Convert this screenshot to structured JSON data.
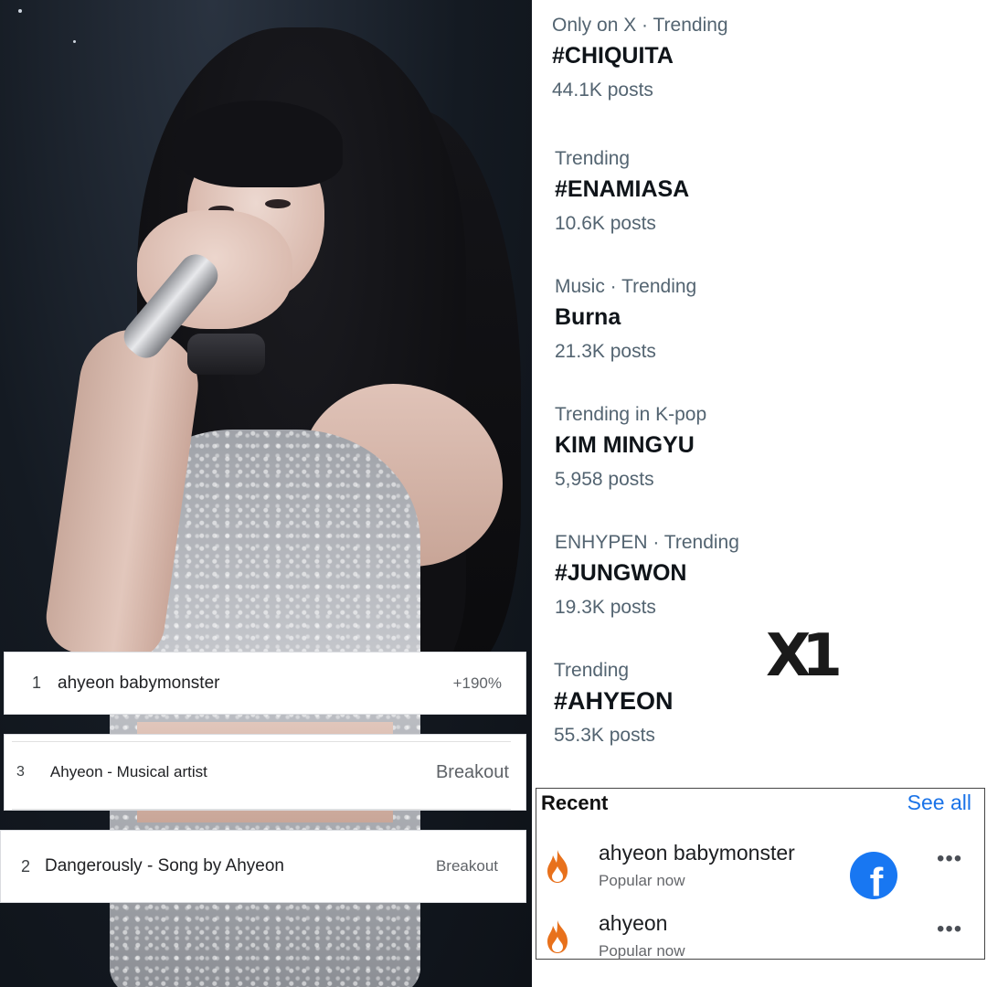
{
  "google_trends": [
    {
      "rank": "1",
      "term": "ahyeon babymonster",
      "value": "+190%"
    },
    {
      "rank": "3",
      "term": "Ahyeon - Musical artist",
      "value": "Breakout"
    },
    {
      "rank": "2",
      "term": "Dangerously - Song by Ahyeon",
      "value": "Breakout"
    }
  ],
  "x_trends": [
    {
      "meta": "Only on X · Trending",
      "title": "#CHIQUITA",
      "count": "44.1K posts"
    },
    {
      "meta": "Trending",
      "title": "#ENAMIASA",
      "count": "10.6K posts"
    },
    {
      "meta": "Music · Trending",
      "title": "Burna",
      "count": "21.3K posts"
    },
    {
      "meta": "Trending in K-pop",
      "title": "KIM MINGYU",
      "count": "5,958 posts"
    },
    {
      "meta": "ENHYPEN · Trending",
      "title": "#JUNGWON",
      "count": "19.3K posts"
    },
    {
      "meta": "Trending",
      "title": "#AHYEON",
      "count": "55.3K posts"
    }
  ],
  "watermark": "X1",
  "recent": {
    "header": "Recent",
    "see_all": "See all",
    "items": [
      {
        "name": "ahyeon babymonster",
        "sub": "Popular now",
        "icon": "fire-icon"
      },
      {
        "name": "ahyeon",
        "sub": "Popular now",
        "icon": "fire-icon"
      }
    ],
    "more": "•••",
    "fb_glyph": "f"
  },
  "colors": {
    "x_meta": "#536471",
    "x_title": "#0f1419",
    "fb_blue": "#1877f2",
    "link_blue": "#1a73e8",
    "fire_orange": "#e8711c"
  }
}
